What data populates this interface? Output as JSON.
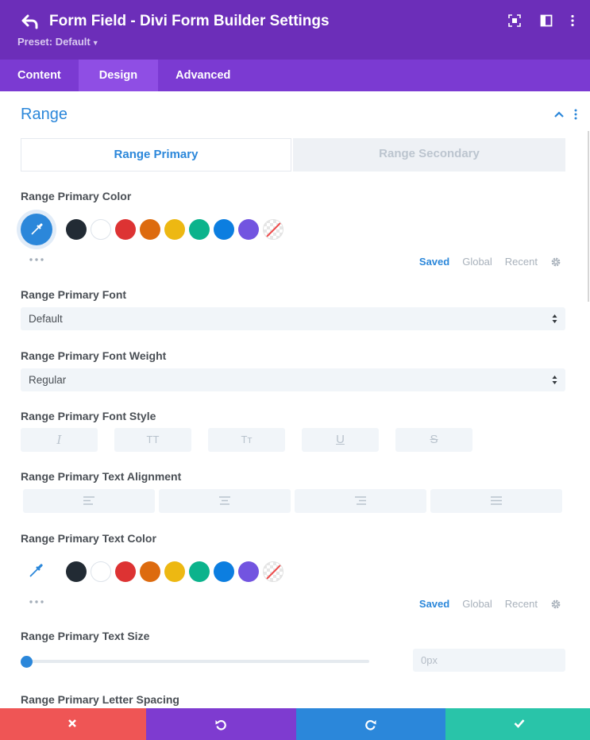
{
  "header": {
    "title": "Form Field - Divi Form Builder Settings",
    "preset": "Preset: Default",
    "icons": [
      "back-arrow-icon",
      "expand-icon",
      "split-view-icon",
      "more-vertical-icon"
    ]
  },
  "tabs": [
    {
      "label": "Content",
      "active": false
    },
    {
      "label": "Design",
      "active": true
    },
    {
      "label": "Advanced",
      "active": false
    }
  ],
  "section": {
    "title": "Range",
    "subtabs": {
      "primary": "Range Primary",
      "secondary": "Range Secondary"
    }
  },
  "fields": {
    "primary_color_label": "Range Primary Color",
    "primary_font_label": "Range Primary Font",
    "primary_font_value": "Default",
    "primary_font_weight_label": "Range Primary Font Weight",
    "primary_font_weight_value": "Regular",
    "primary_font_style_label": "Range Primary Font Style",
    "font_style_buttons": [
      "I",
      "TT",
      "Tт",
      "U",
      "S"
    ],
    "primary_text_alignment_label": "Range Primary Text Alignment",
    "primary_text_color_label": "Range Primary Text Color",
    "primary_text_size_label": "Range Primary Text Size",
    "primary_text_size_value": "0px",
    "primary_text_size_level": 0,
    "primary_letter_spacing_label": "Range Primary Letter Spacing"
  },
  "palette": {
    "swatches": [
      "#222b34",
      "#ffffff",
      "#dd3333",
      "#dd6b0f",
      "#edb812",
      "#0bb38c",
      "#0c7ee0",
      "#7254e0",
      "none"
    ],
    "tabs": [
      "Saved",
      "Global",
      "Recent"
    ],
    "active_tab": "Saved"
  },
  "footer": {
    "buttons": [
      {
        "name": "cancel",
        "color": "#ef5555"
      },
      {
        "name": "undo",
        "color": "#7e3bd0"
      },
      {
        "name": "redo",
        "color": "#2b87da"
      },
      {
        "name": "save",
        "color": "#29c4a9"
      }
    ]
  },
  "colors": {
    "header": "#6c2eb9",
    "tabs": "#7b3ad2",
    "tab_active": "#8f4ee4",
    "accent": "#2b87da"
  }
}
